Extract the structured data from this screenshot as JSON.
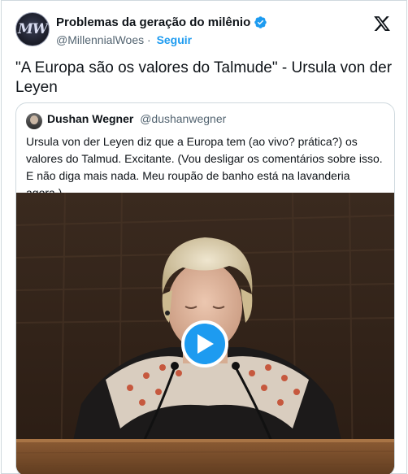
{
  "author": {
    "display_name": "Problemas da geração do milênio",
    "handle": "@MillennialWoes",
    "separator": "·",
    "follow_label": "Seguir",
    "avatar_text": "MW"
  },
  "tweet": {
    "text": "\"A Europa são os valores do Talmude\" - Ursula von der Leyen"
  },
  "quoted": {
    "display_name": "Dushan Wegner",
    "handle": "@dushanwegner",
    "text": "Ursula von der Leyen diz que a Europa tem (ao vivo? prática?) os valores do Talmud. Excitante. (Vou desligar os comentários sobre isso. E não diga mais nada. Meu roupão de banho está na lavanderia agora.)"
  },
  "icons": {
    "verified": "verified-badge-icon",
    "logo": "x-logo-icon",
    "play": "play-icon"
  },
  "colors": {
    "accent": "#1d9bf0",
    "text": "#0f1419",
    "muted": "#536471",
    "border": "#cfd9de"
  }
}
